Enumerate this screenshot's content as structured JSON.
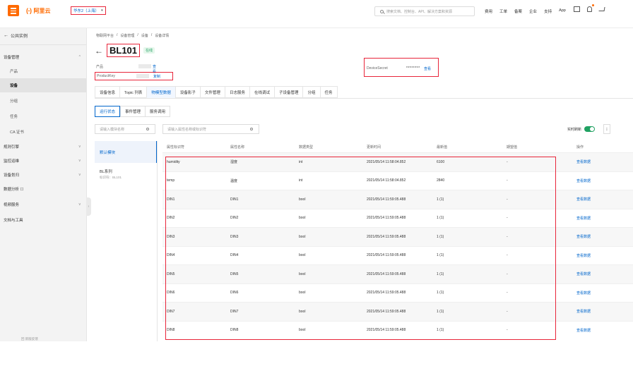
{
  "topbar": {
    "logo_mark": "(-)",
    "logo_text": "阿里云",
    "region": "华东2（上海）",
    "search_placeholder": "搜索文档、控制台、API、解决方案和资源",
    "nav": [
      "费用",
      "工单",
      "备案",
      "企业",
      "支持",
      "App"
    ]
  },
  "sidebar": {
    "back": "公共实例",
    "items": [
      {
        "label": "设备管理",
        "type": "group",
        "chev": "^"
      },
      {
        "label": "产品",
        "type": "sub"
      },
      {
        "label": "设备",
        "type": "sub",
        "active": true
      },
      {
        "label": "分组",
        "type": "sub"
      },
      {
        "label": "任务",
        "type": "sub"
      },
      {
        "label": "CA 证书",
        "type": "sub"
      },
      {
        "label": "规则引擎",
        "type": "group",
        "chev": "v"
      },
      {
        "label": "监控运维",
        "type": "group",
        "chev": "v"
      },
      {
        "label": "设备划归",
        "type": "group",
        "chev": "v"
      },
      {
        "label": "数据分析 ☐",
        "type": "group"
      },
      {
        "label": "视频服务",
        "type": "group",
        "chev": "v"
      },
      {
        "label": "文档与工具",
        "type": "group"
      }
    ],
    "footer": "回 新版反馈"
  },
  "main": {
    "breadcrumb": [
      "物联网平台",
      "/",
      "设备管理",
      "/",
      "设备",
      "/",
      "设备详情"
    ],
    "device_name": "BL101",
    "status": "在线",
    "product_label": "产品",
    "product_link": "查看",
    "productkey_label": "ProductKey",
    "productkey_link": "复制",
    "devicesecret_label": "DeviceSecret",
    "devicesecret_value": "********",
    "devicesecret_link": "查看",
    "tabs": [
      "设备信息",
      "Topic 列表",
      "物模型数据",
      "设备影子",
      "文件管理",
      "日志服务",
      "在线调试",
      "子设备管理",
      "分组",
      "任务"
    ],
    "active_tab": 2,
    "subtabs": [
      "运行状态",
      "事件管理",
      "服务调用"
    ],
    "module_search_placeholder": "请输入模块名称",
    "prop_search_placeholder": "请输入属性名称或标识符",
    "realtime_label": "实时刷新",
    "edge_glyph": "⁝",
    "modules": [
      {
        "name": "默认模块",
        "sub": "",
        "active": true
      },
      {
        "name": "BL系列",
        "sub": "标识符：BL101"
      }
    ],
    "table": {
      "headers": [
        "属性标识符",
        "属性名称",
        "数据类型",
        "更新时间",
        "最新值",
        "期望值",
        "操作"
      ],
      "rows": [
        [
          "humidity",
          "湿度",
          "int",
          "2021/05/14 11:58:04.852",
          "6100",
          "-",
          "查看数据"
        ],
        [
          "temp",
          "温度",
          "int",
          "2021/05/14 11:58:04.852",
          "2840",
          "-",
          "查看数据"
        ],
        [
          "DIN1",
          "DIN1",
          "bool",
          "2021/05/14 11:59:05.488",
          "1 (1)",
          "-",
          "查看数据"
        ],
        [
          "DIN2",
          "DIN2",
          "bool",
          "2021/05/14 11:59:05.488",
          "1 (1)",
          "-",
          "查看数据"
        ],
        [
          "DIN3",
          "DIN3",
          "bool",
          "2021/05/14 11:59:05.488",
          "1 (1)",
          "-",
          "查看数据"
        ],
        [
          "DIN4",
          "DIN4",
          "bool",
          "2021/05/14 11:59:05.488",
          "1 (1)",
          "-",
          "查看数据"
        ],
        [
          "DIN5",
          "DIN5",
          "bool",
          "2021/05/14 11:59:05.488",
          "1 (1)",
          "-",
          "查看数据"
        ],
        [
          "DIN6",
          "DIN6",
          "bool",
          "2021/05/14 11:59:05.488",
          "1 (1)",
          "-",
          "查看数据"
        ],
        [
          "DIN7",
          "DIN7",
          "bool",
          "2021/05/14 11:59:05.488",
          "1 (1)",
          "-",
          "查看数据"
        ],
        [
          "DIN8",
          "DIN8",
          "bool",
          "2021/05/14 11:59:05.488",
          "1 (1)",
          "-",
          "查看数据"
        ]
      ]
    }
  },
  "colors": {
    "brand": "#ff6a00",
    "link": "#0066cc",
    "highlight": "#e8253a",
    "online": "#20a162"
  }
}
